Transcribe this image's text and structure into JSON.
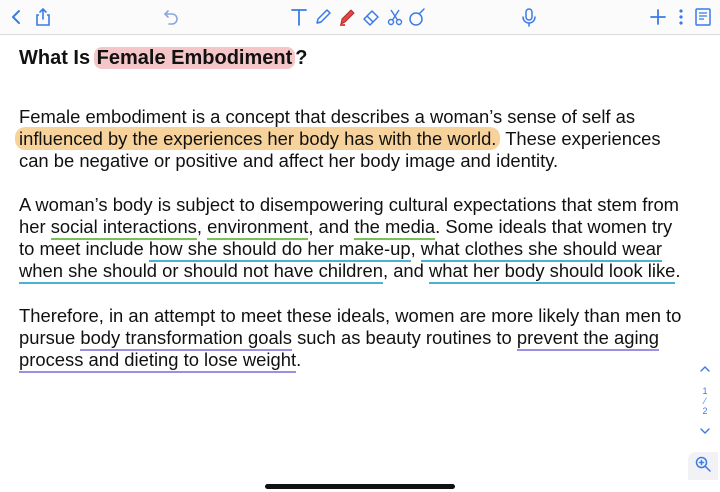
{
  "toolbar": {
    "left_icons": [
      "chevron-left-icon",
      "share-icon",
      "undo-icon"
    ],
    "tool_icons": [
      "text-tool-icon",
      "pen-icon",
      "highlighter-icon",
      "eraser-icon",
      "lasso-icon",
      "shapes-icon"
    ],
    "right_icons": [
      "microphone-icon",
      "plus-icon",
      "more-icon",
      "page-view-icon"
    ],
    "accent_color": "#3b7be6",
    "highlighter_color": "#e04848"
  },
  "heading": {
    "prefix": "What Is ",
    "highlighted": "Female Embodiment",
    "suffix": "?"
  },
  "para1": {
    "l1_a": "Female ",
    "l1_b": "embodiment",
    "l1_c": " is a concept that describes a woman’s sense of self as",
    "l2_hl": "influenced by the experiences her body has with the world.",
    "l2_rest": " These experiences",
    "l3": "can be negative or positive and affect her body image and identity."
  },
  "para2": {
    "l1": "A woman’s body is subject to disempowering cultural expectations that stem from",
    "l2_a": "her ",
    "l2_b": "social interactions",
    "l2_c": ", ",
    "l2_d": "environment",
    "l2_e": ", and ",
    "l2_f": "the media",
    "l2_g": ". Some ideals that women try",
    "l3_a": "to meet include ",
    "l3_b": "how she should do her make-up",
    "l3_c": ", ",
    "l3_d": "what clothes she should wear",
    "l4_a": "when she should or should not have children",
    "l4_b": ", and ",
    "l4_c": "what her body should look like",
    "l4_d": "."
  },
  "para3": {
    "l1": "Therefore, in an attempt to meet these ideals, women are more likely than men to",
    "l2_a": "pursue ",
    "l2_b": "body transformation goals",
    "l2_c": " such as beauty routines to ",
    "l2_d": "prevent the aging",
    "l3_a": "process and dieting to lose weight",
    "l3_b": "."
  },
  "page_indicator": {
    "current": "1",
    "total": "2"
  },
  "annotation_colors": {
    "heading_highlight": "#f4c6c8",
    "orange_highlight": "#f7d39b",
    "green_underline": "#7bbf5b",
    "teal_underline": "#4ab3d1",
    "purple_underline": "#9c8ee0"
  }
}
